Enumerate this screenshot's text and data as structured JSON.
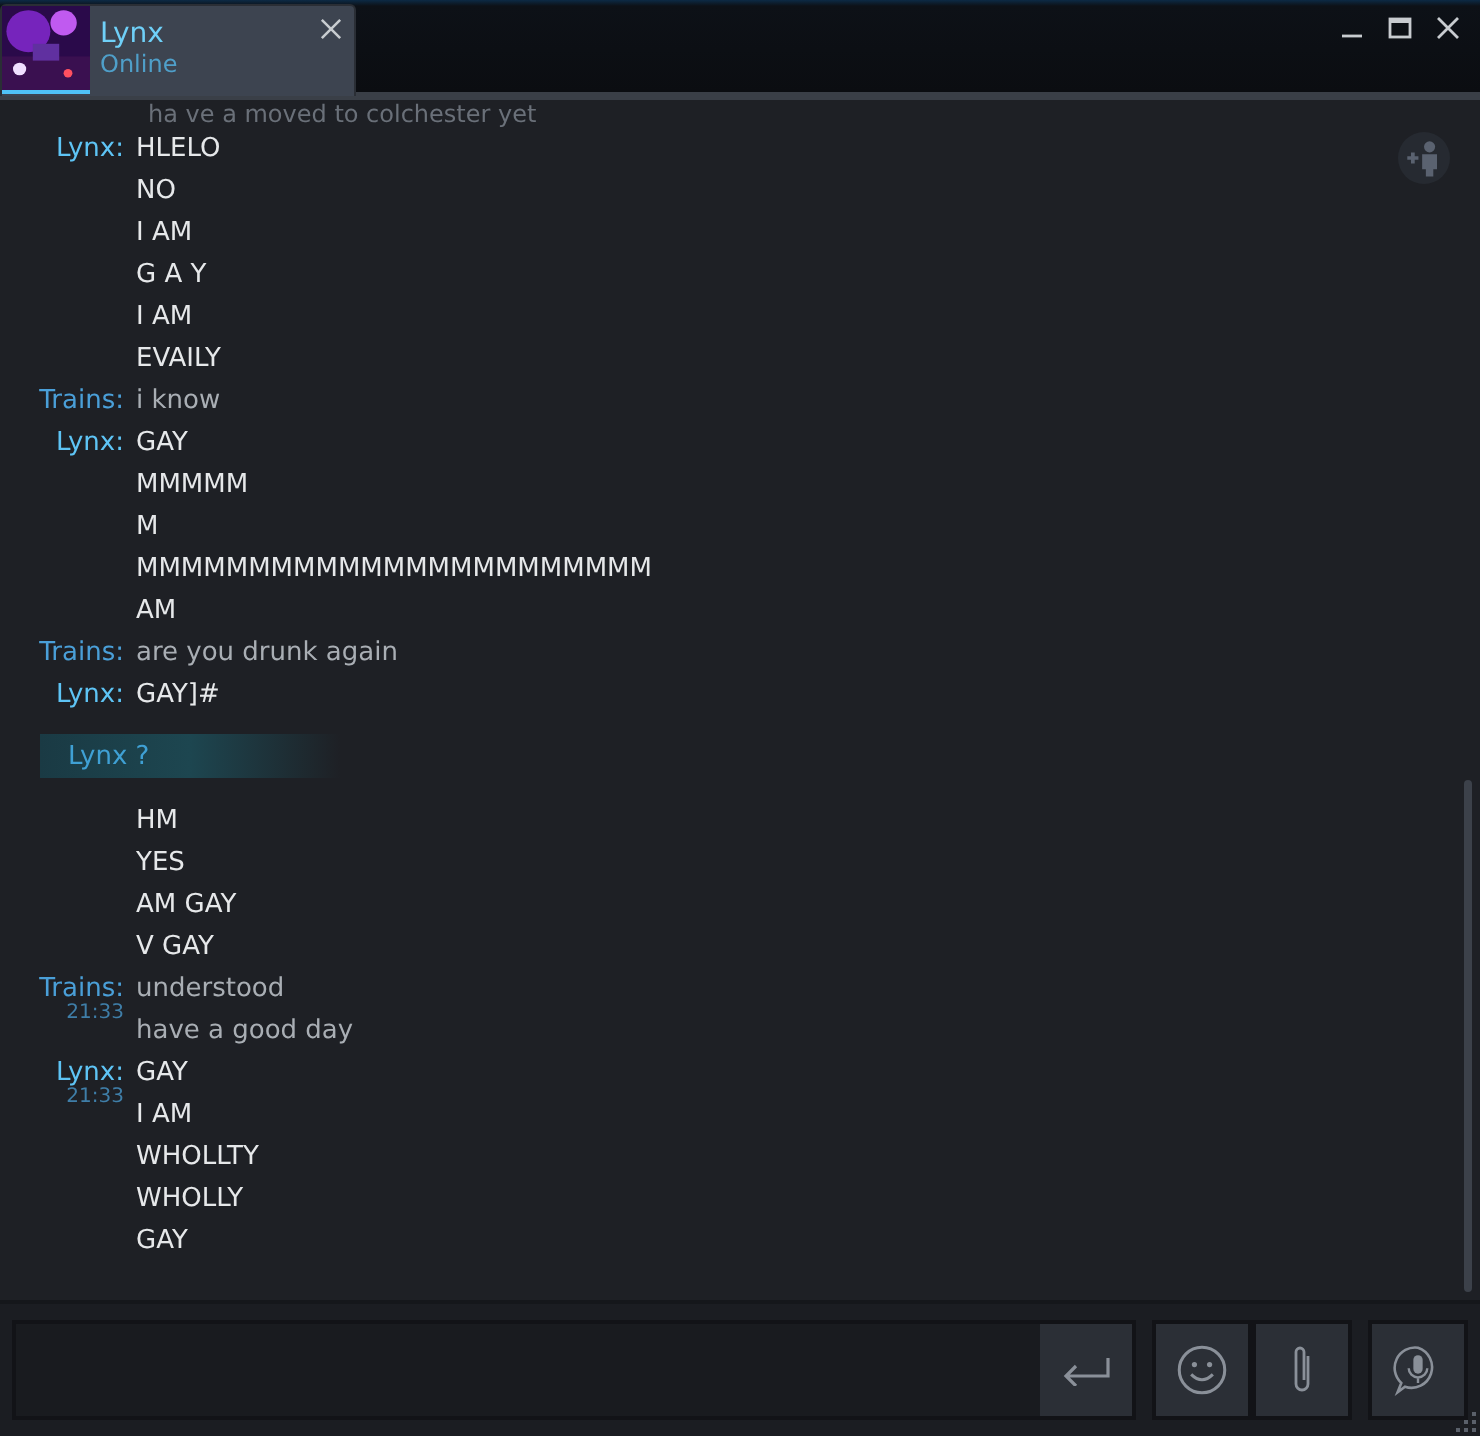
{
  "tab": {
    "name": "Lynx",
    "status": "Online",
    "selected": true
  },
  "messages": [
    {
      "kind": "cut",
      "lines": [
        "ha ve a moved to colchester yet"
      ]
    },
    {
      "kind": "self",
      "sender": "Lynx:",
      "color": "#5ec4f5",
      "lines": [
        "HLELO",
        "NO",
        "I AM",
        "G A Y",
        "I AM",
        "EVAILY"
      ]
    },
    {
      "kind": "friend",
      "sender": "Trains:",
      "color": "#4a9fd8",
      "lines": [
        "i know"
      ]
    },
    {
      "kind": "self",
      "sender": "Lynx:",
      "color": "#5ec4f5",
      "lines": [
        "GAY",
        "MMMMM",
        "M",
        "MMMMMMMMMMMMMMMMMMMMMMM",
        "AM"
      ]
    },
    {
      "kind": "friend",
      "sender": "Trains:",
      "color": "#4a9fd8",
      "lines": [
        "are you drunk again"
      ]
    },
    {
      "kind": "self",
      "sender": "Lynx:",
      "color": "#5ec4f5",
      "lines": [
        "GAY]#"
      ]
    },
    {
      "kind": "notice",
      "text": "Lynx ?"
    },
    {
      "kind": "self",
      "lines": [
        "HM",
        "YES",
        "AM GAY",
        "V GAY"
      ]
    },
    {
      "kind": "friend",
      "sender": "Trains:",
      "time": "21:33",
      "color": "#4a9fd8",
      "lines": [
        "understood",
        "have a good day"
      ]
    },
    {
      "kind": "self",
      "sender": "Lynx:",
      "time": "21:33",
      "color": "#5ec4f5",
      "lines": [
        "GAY",
        "I AM",
        "WHOLLTY",
        "WHOLLY",
        "GAY"
      ]
    }
  ]
}
